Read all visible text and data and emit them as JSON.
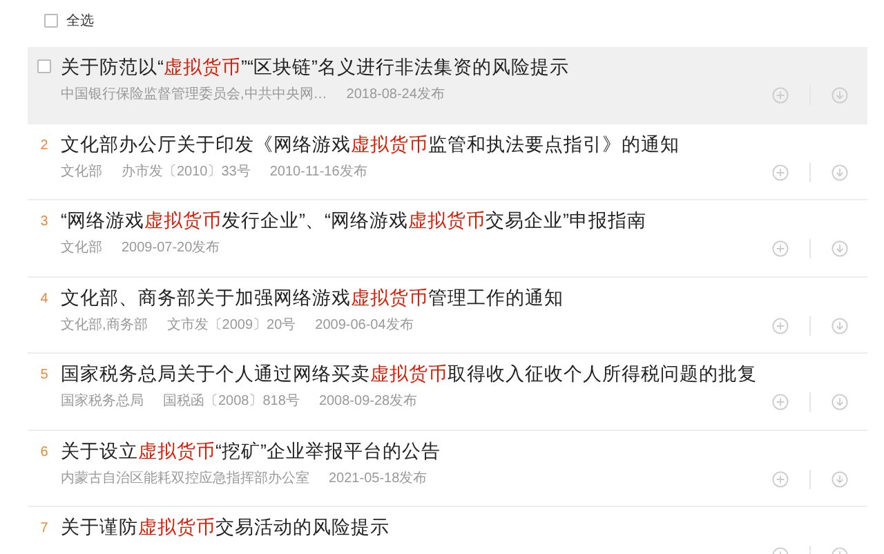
{
  "select_all": {
    "label": "全选",
    "checked": false
  },
  "results": [
    {
      "kind": "checkbox",
      "checked": false,
      "highlighted": true,
      "title": [
        {
          "text": "关于防范以“",
          "highlight": false
        },
        {
          "text": "虚拟货币",
          "highlight": true
        },
        {
          "text": "”“区块链”名义进行非法集资的风险提示",
          "highlight": false
        }
      ],
      "meta": [
        "中国银行保险监督管理委员会,中共中央网…",
        "2018-08-24发布"
      ]
    },
    {
      "kind": "number",
      "number": "2",
      "highlighted": false,
      "title": [
        {
          "text": "文化部办公厅关于印发《网络游戏",
          "highlight": false
        },
        {
          "text": "虚拟货币",
          "highlight": true
        },
        {
          "text": "监管和执法要点指引》的通知",
          "highlight": false
        }
      ],
      "meta": [
        "文化部",
        "办市发〔2010〕33号",
        "2010-11-16发布"
      ]
    },
    {
      "kind": "number",
      "number": "3",
      "highlighted": false,
      "title": [
        {
          "text": "“网络游戏",
          "highlight": false
        },
        {
          "text": "虚拟货币",
          "highlight": true
        },
        {
          "text": "发行企业”、“网络游戏",
          "highlight": false
        },
        {
          "text": "虚拟货币",
          "highlight": true
        },
        {
          "text": "交易企业”申报指南",
          "highlight": false
        }
      ],
      "meta": [
        "文化部",
        "2009-07-20发布"
      ]
    },
    {
      "kind": "number",
      "number": "4",
      "highlighted": false,
      "title": [
        {
          "text": "文化部、商务部关于加强网络游戏",
          "highlight": false
        },
        {
          "text": "虚拟货币",
          "highlight": true
        },
        {
          "text": "管理工作的通知",
          "highlight": false
        }
      ],
      "meta": [
        "文化部,商务部",
        "文市发〔2009〕20号",
        "2009-06-04发布"
      ]
    },
    {
      "kind": "number",
      "number": "5",
      "highlighted": false,
      "title": [
        {
          "text": "国家税务总局关于个人通过网络买卖",
          "highlight": false
        },
        {
          "text": "虚拟货币",
          "highlight": true
        },
        {
          "text": "取得收入征收个人所得税问题的批复",
          "highlight": false
        }
      ],
      "meta": [
        "国家税务总局",
        "国税函〔2008〕818号",
        "2008-09-28发布"
      ]
    },
    {
      "kind": "number",
      "number": "6",
      "highlighted": false,
      "title": [
        {
          "text": "关于设立",
          "highlight": false
        },
        {
          "text": "虚拟货币",
          "highlight": true
        },
        {
          "text": "“挖矿”企业举报平台的公告",
          "highlight": false
        }
      ],
      "meta": [
        "内蒙古自治区能耗双控应急指挥部办公室",
        "2021-05-18发布"
      ]
    },
    {
      "kind": "number",
      "number": "7",
      "highlighted": false,
      "title": [
        {
          "text": "关于谨防",
          "highlight": false
        },
        {
          "text": "虚拟货币",
          "highlight": true
        },
        {
          "text": "交易活动的风险提示",
          "highlight": false
        }
      ]
    }
  ]
}
